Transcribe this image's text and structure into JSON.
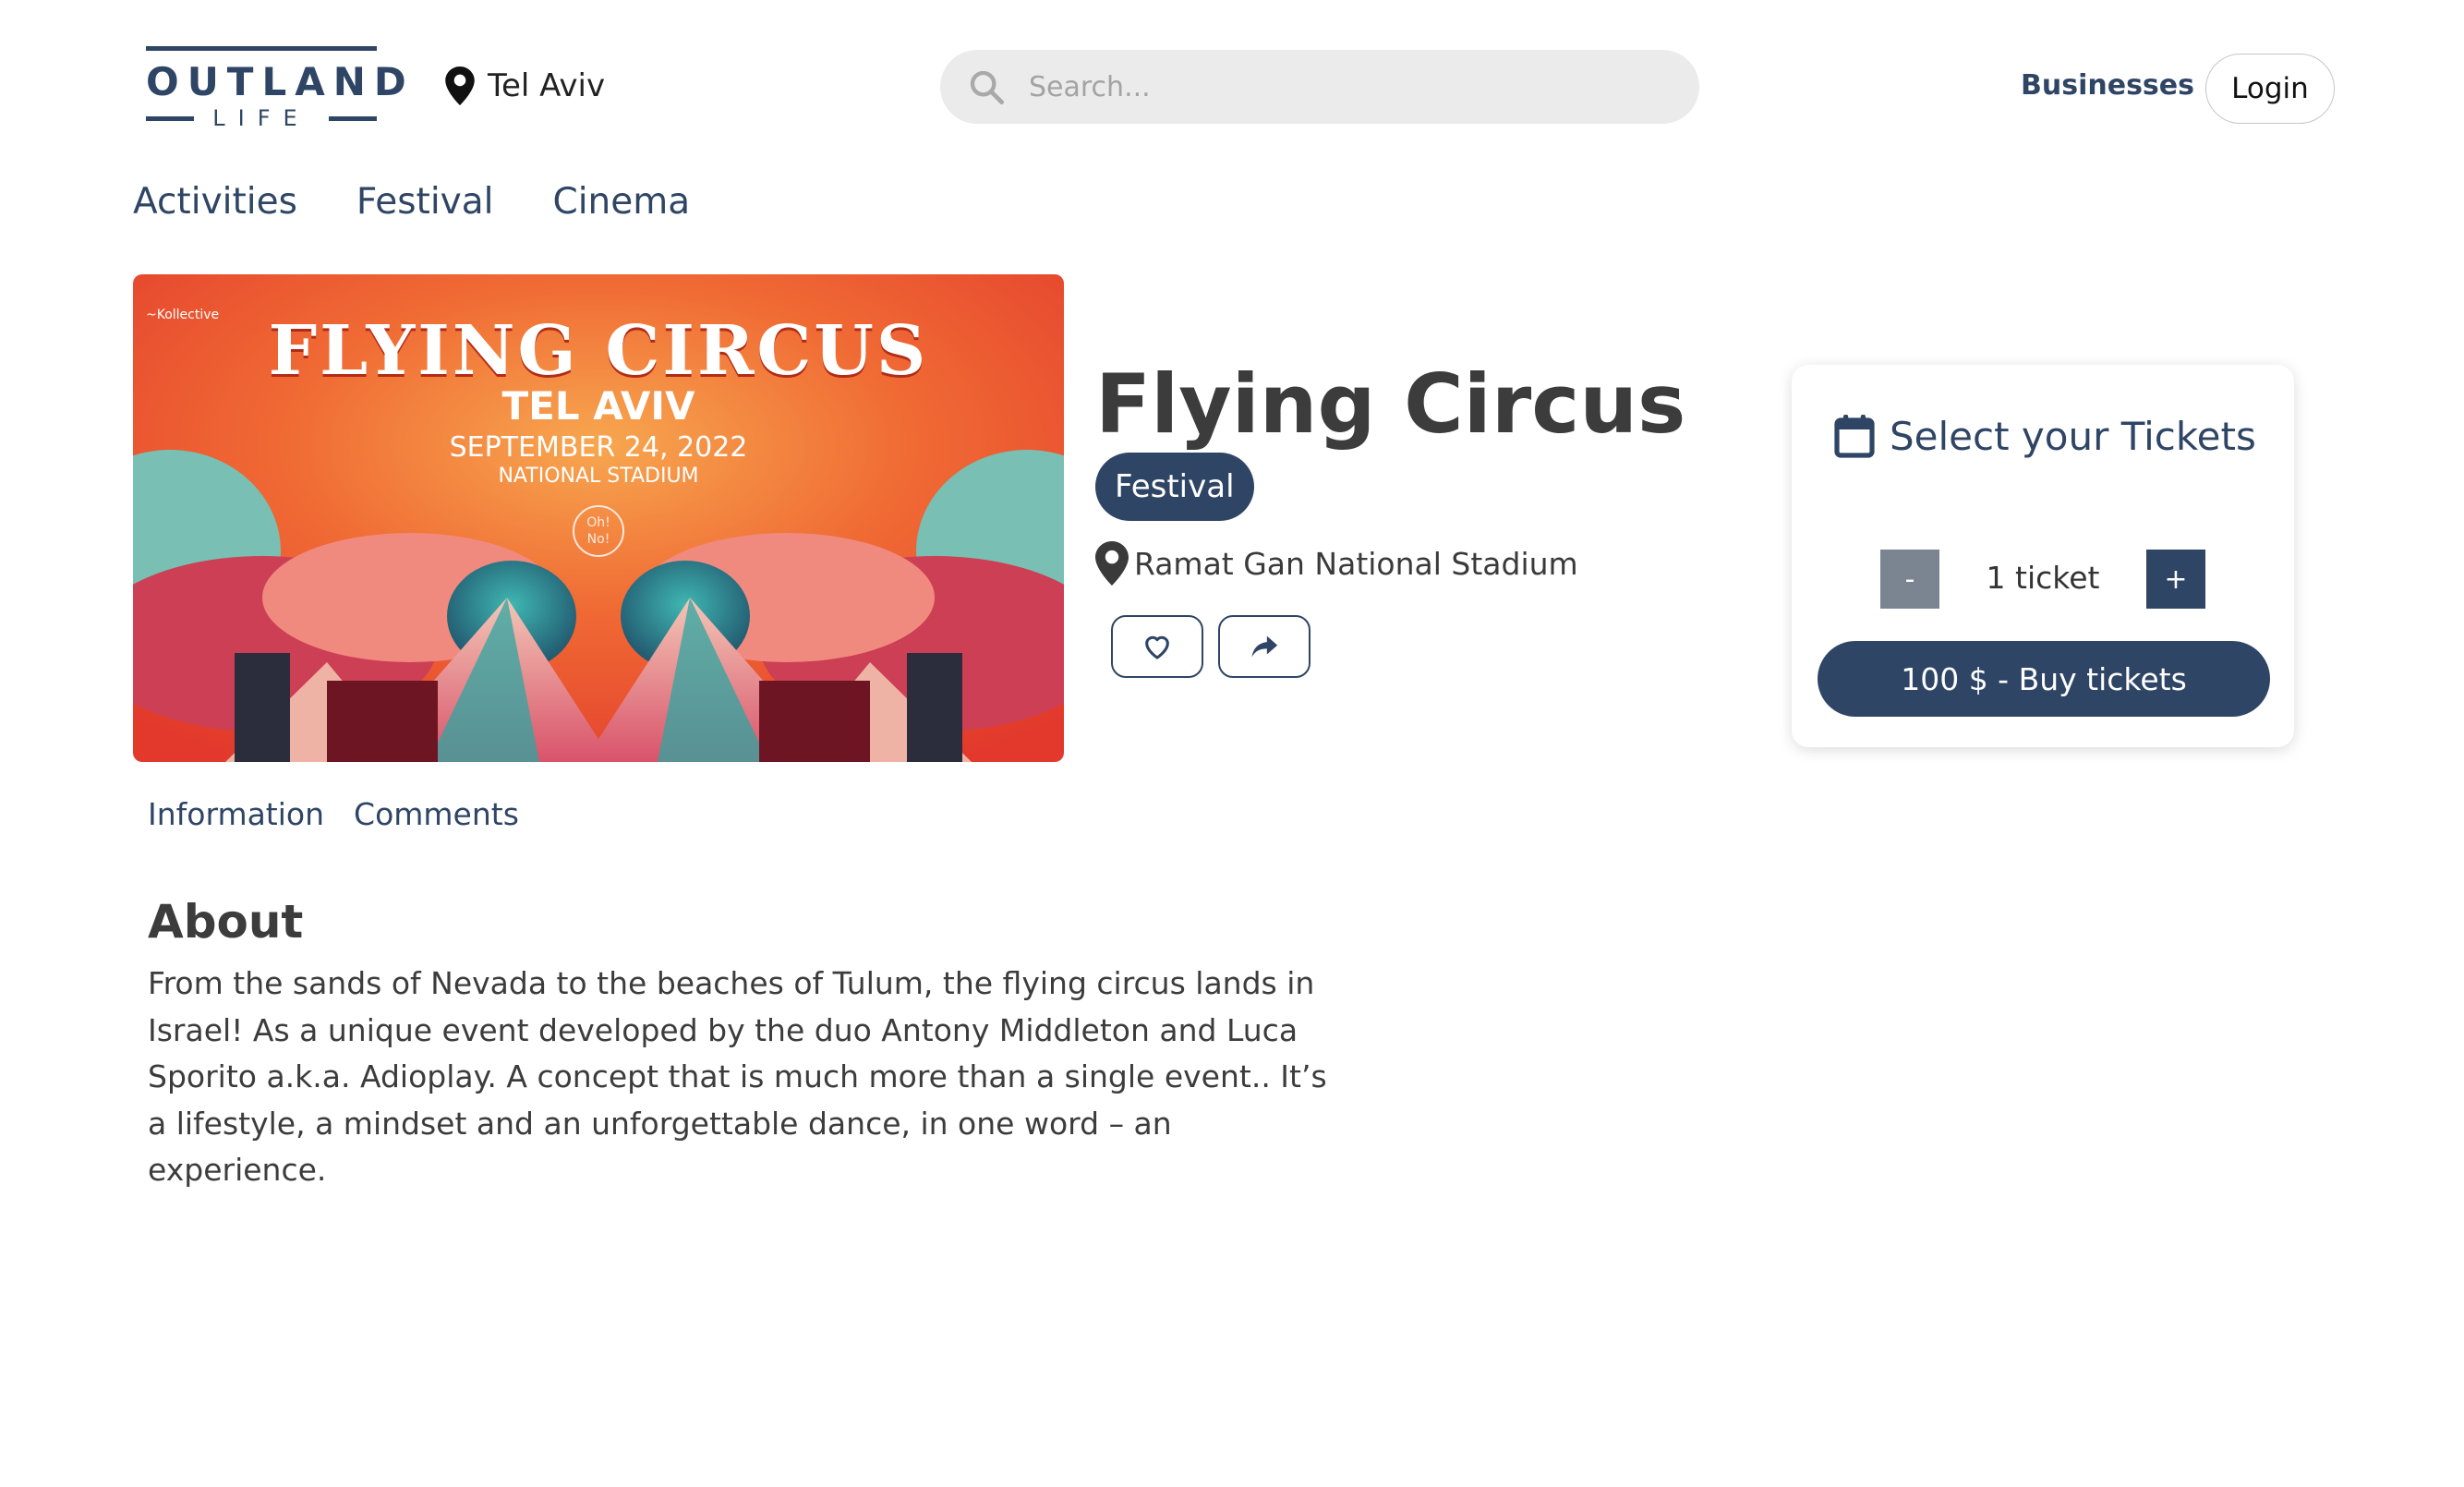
{
  "header": {
    "logo_word": "OUTLAND",
    "logo_sub": "LIFE",
    "city": "Tel Aviv",
    "search_placeholder": "Search...",
    "businesses_label": "Businesses",
    "login_label": "Login"
  },
  "nav": {
    "categories": [
      "Activities",
      "Festival",
      "Cinema"
    ]
  },
  "poster": {
    "brand": "~Kollective",
    "title": "FLYING CIRCUS",
    "city": "TEL AVIV",
    "date": "SEPTEMBER 24, 2022",
    "venue": "NATIONAL STADIUM",
    "badge": "Oh! No!"
  },
  "event": {
    "title": "Flying Circus",
    "tag": "Festival",
    "venue": "Ramat Gan National Stadium"
  },
  "tickets": {
    "heading": "Select your Tickets",
    "minus_label": "-",
    "plus_label": "+",
    "quantity_label": "1 ticket",
    "buy_label": "100 $ - Buy tickets"
  },
  "tabs": {
    "information": "Information",
    "comments": "Comments"
  },
  "about": {
    "heading": "About",
    "text": "From the sands of Nevada to the beaches of Tulum, the flying circus lands in Israel! As a unique event developed by the duo Antony Middleton and Luca Sporito a.k.a. Adioplay. A concept that is much more than a single event.. It’s a lifestyle, a mindset and an unforgettable dance, in one word – an experience."
  },
  "colors": {
    "brand": "#2f4565",
    "minus_button": "#7b8491",
    "search_bg": "#ebebeb"
  },
  "icons": [
    "map-pin-icon",
    "search-icon",
    "calendar-icon",
    "heart-icon",
    "share-icon"
  ]
}
